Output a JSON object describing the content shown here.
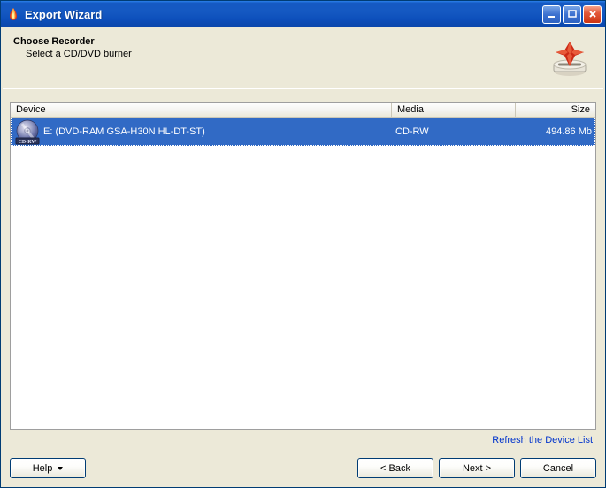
{
  "window": {
    "title": "Export Wizard"
  },
  "header": {
    "heading": "Choose Recorder",
    "subheading": "Select a CD/DVD burner"
  },
  "columns": {
    "device": "Device",
    "media": "Media",
    "size": "Size"
  },
  "rows": [
    {
      "device": "E: (DVD-RAM GSA-H30N HL-DT-ST)",
      "media": "CD-RW",
      "size": "494.86 Mb",
      "selected": true,
      "icon_badge": "CD-RW"
    }
  ],
  "links": {
    "refresh": "Refresh the Device List"
  },
  "buttons": {
    "help": "Help",
    "back": "< Back",
    "next": "Next >",
    "cancel": "Cancel"
  }
}
